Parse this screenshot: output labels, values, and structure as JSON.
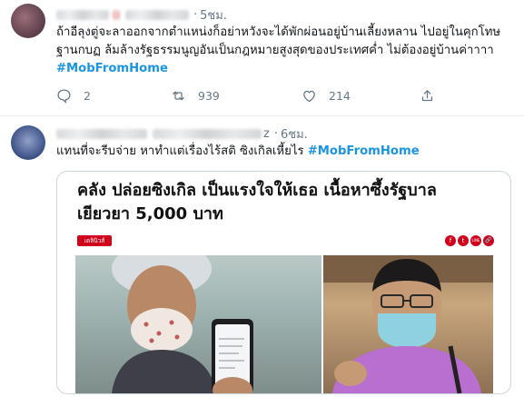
{
  "tweets": [
    {
      "time": "5ชม.",
      "text": "ถ้าอีลุงตู่จะลาออกจากตำแหน่งก็อย่าหวังจะได้พักผ่อนอยู่บ้านเลี้ยงหลาน ไปอยู่ในคุกโทษฐานกบฏ ล้มล้างรัฐธรรมนูญอันเป็นกฎหมายสูงสุดของประเทศค่ำ ไม่ต้องอยู่บ้านค่าาาา",
      "hashtag": "#MobFromHome",
      "replies": "2",
      "retweets": "939",
      "likes": "214"
    },
    {
      "handle_tail": "z",
      "time": "6ชม.",
      "text": "แทนที่จะรีบจ่าย หาทำแต่เรื่องไร้สติ ซิงเกิลเหี้ยไร ",
      "hashtag": "#MobFromHome",
      "card": {
        "headline": "คลัง ปล่อยซิงเกิล เป็นแรงใจให้เธอ เนื้อหาซึ้งรัฐบาล เยียวยา 5,000 บาท",
        "source_label": "เดลินิวส์ออนไลน์",
        "share_icons": [
          "f",
          "t",
          "LINE",
          "🔗"
        ]
      }
    }
  ],
  "colors": {
    "hashtag": "#1b95e0",
    "meta": "#657786",
    "brand_red": "#d0021b"
  }
}
